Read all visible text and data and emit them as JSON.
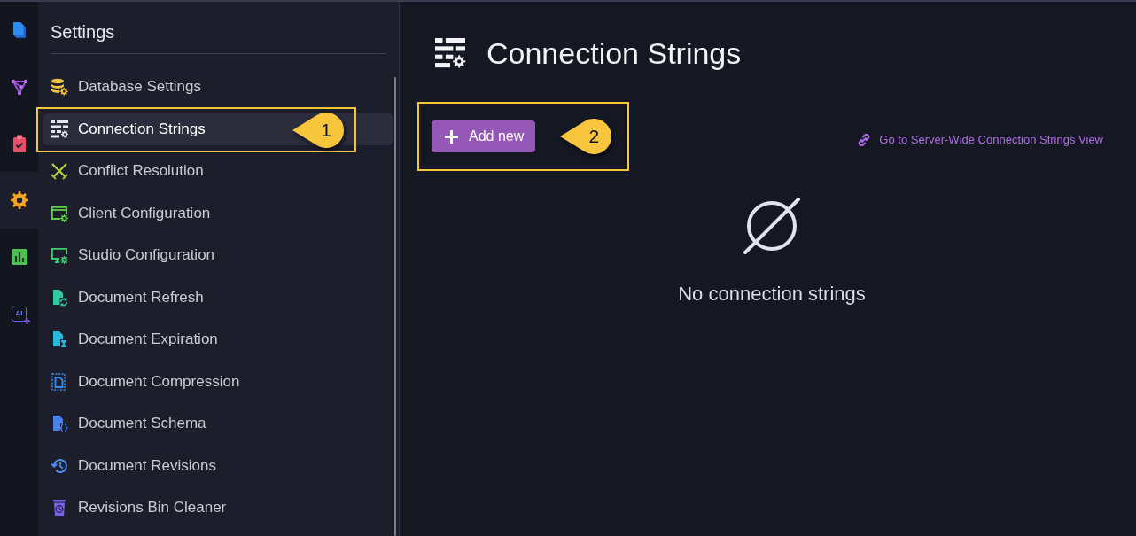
{
  "rail": {
    "items": [
      {
        "selected": false
      },
      {
        "selected": false
      },
      {
        "selected": false
      },
      {
        "selected": true
      },
      {
        "selected": false
      },
      {
        "selected": false,
        "icon_text": "AI"
      }
    ]
  },
  "sidebar": {
    "title": "Settings",
    "items": [
      {
        "label": "Database Settings",
        "selected": false
      },
      {
        "label": "Connection Strings",
        "selected": true
      },
      {
        "label": "Conflict Resolution",
        "selected": false
      },
      {
        "label": "Client Configuration",
        "selected": false
      },
      {
        "label": "Studio Configuration",
        "selected": false
      },
      {
        "label": "Document Refresh",
        "selected": false
      },
      {
        "label": "Document Expiration",
        "selected": false
      },
      {
        "label": "Document Compression",
        "selected": false
      },
      {
        "label": "Document Schema",
        "selected": false
      },
      {
        "label": "Document Revisions",
        "selected": false
      },
      {
        "label": "Revisions Bin Cleaner",
        "selected": false
      }
    ]
  },
  "main": {
    "title": "Connection Strings",
    "add_button": {
      "label": "Add new"
    },
    "server_wide_link": {
      "label": "Go to Server-Wide Connection Strings View"
    },
    "empty_state": {
      "message": "No connection strings"
    }
  },
  "callouts": [
    {
      "number": "1"
    },
    {
      "number": "2"
    }
  ]
}
